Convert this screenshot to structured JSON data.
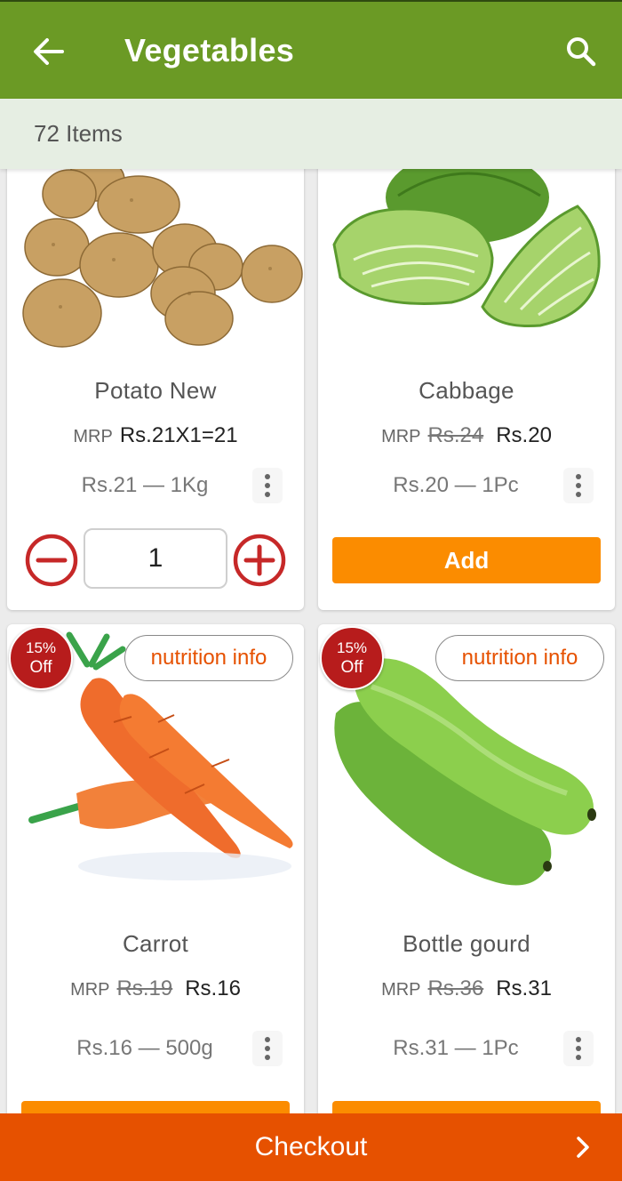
{
  "header": {
    "title": "Vegetables",
    "back_icon": "arrow-left-icon",
    "search_icon": "search-icon"
  },
  "summary": {
    "count_text": "72 Items"
  },
  "products": [
    {
      "name": "Potato New",
      "mrp_label": "MRP",
      "mrp_old": "",
      "price": "Rs.21X1=21",
      "unit": "Rs.21 — 1Kg",
      "quantity": "1",
      "add_label": ""
    },
    {
      "name": "Cabbage",
      "mrp_label": "MRP",
      "mrp_old": "Rs.24",
      "price": "Rs.20",
      "unit": "Rs.20 — 1Pc",
      "add_label": "Add"
    },
    {
      "name": "Carrot",
      "mrp_label": "MRP",
      "mrp_old": "Rs.19",
      "price": "Rs.16",
      "unit": "Rs.16 — 500g",
      "badge_pct": "15%",
      "badge_off": "Off",
      "nutrition_label": "nutrition info"
    },
    {
      "name": "Bottle gourd",
      "mrp_label": "MRP",
      "mrp_old": "Rs.36",
      "price": "Rs.31",
      "unit": "Rs.31 — 1Pc",
      "badge_pct": "15%",
      "badge_off": "Off",
      "nutrition_label": "nutrition info"
    }
  ],
  "footer": {
    "checkout_label": "Checkout",
    "chevron_icon": "chevron-right-icon"
  },
  "colors": {
    "appbar": "#6b9a25",
    "accent": "#fb8c00",
    "checkout": "#e65100",
    "badge": "#b71c1c",
    "stepper": "#c62828"
  }
}
